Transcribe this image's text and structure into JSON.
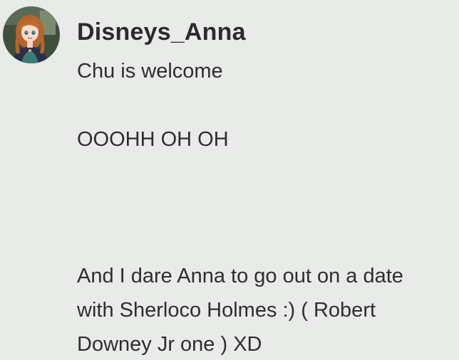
{
  "comment": {
    "username": "Disneys_Anna",
    "avatar_icon": "anna-avatar-icon",
    "lines": [
      "Chu is welcome",
      "OOOHH OH OH",
      "And I dare Anna to go out on a date",
      "with Sherloco Holmes :) ( Robert",
      "Downey Jr one ) XD"
    ]
  },
  "colors": {
    "background": "#e8ebe8",
    "text": "#2e2e2e"
  }
}
